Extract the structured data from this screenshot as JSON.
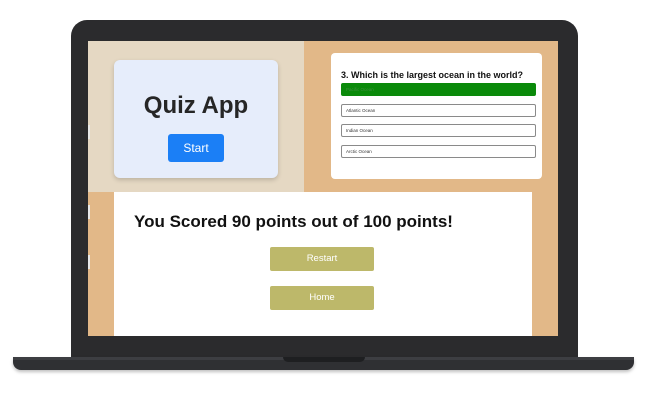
{
  "start_screen": {
    "title": "Quiz App",
    "start_label": "Start"
  },
  "question_screen": {
    "question": "3. Which is the largest ocean in the world?",
    "options": [
      {
        "label": "Pacific Ocean",
        "selected": true
      },
      {
        "label": "Atlantic Ocean",
        "selected": false
      },
      {
        "label": "Indian Ocean",
        "selected": false
      },
      {
        "label": "Arctic Ocean",
        "selected": false
      }
    ],
    "selected_color": "#0a8a0a"
  },
  "result_screen": {
    "score_text": "You Scored 90 points out of 100 points!",
    "restart_label": "Restart",
    "home_label": "Home",
    "button_color": "#bdb86a"
  },
  "colors": {
    "start_button": "#1b7ff6",
    "laptop_bezel": "#2b2b2d",
    "screen_background": "#e2b888"
  }
}
